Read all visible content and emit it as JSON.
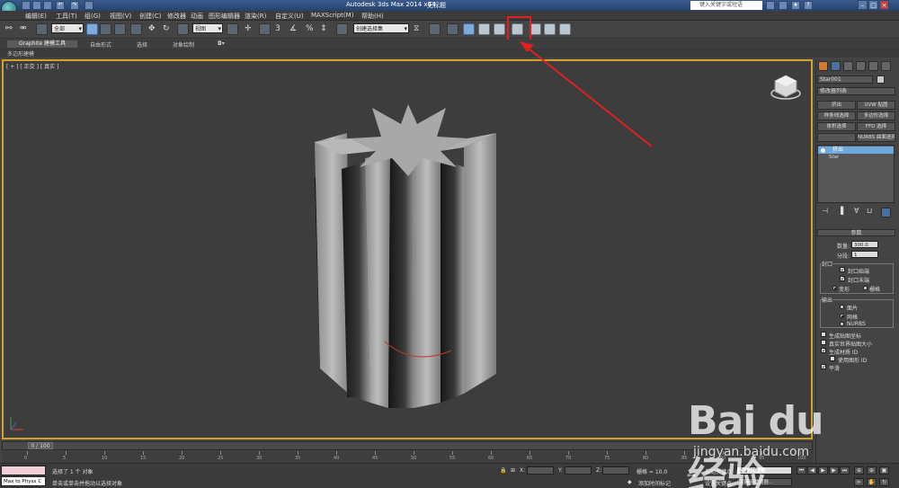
{
  "window": {
    "title": "Autodesk 3ds Max  2014 x64",
    "document": "无标题",
    "help_search_placeholder": "键入关键字或短语"
  },
  "menu": [
    "编辑(E)",
    "工具(T)",
    "组(G)",
    "视图(V)",
    "创建(C)",
    "修改器",
    "动画",
    "图形编辑器",
    "渲染(R)",
    "自定义(U)",
    "MAXScript(M)",
    "帮助(H)"
  ],
  "toolbar": {
    "selection_filter": "全部",
    "ref_coord": "视图",
    "named_selection": "创建选择集"
  },
  "ribbon": {
    "tabs": [
      "Graphite 建模工具",
      "自由形式",
      "选择",
      "对象绘制"
    ],
    "sub_label": "多边形建模"
  },
  "viewport": {
    "label": "[ + ] [ 正交 ] [ 真实 ]"
  },
  "command_panel": {
    "object_name": "Star001",
    "modifier_list": "修改器列表",
    "modifier_buttons": [
      "挤出",
      "UVW 贴图",
      "样条线选择",
      "多边形选择",
      "体积选择",
      "FFD 选择",
      "",
      "NURBS 曲面选择"
    ],
    "stack": {
      "selected": "挤出",
      "base": "Star"
    },
    "params_title": "参数",
    "amount_label": "数量:",
    "amount_value": "300.0",
    "segments_label": "分段:",
    "segments_value": "1",
    "capping_label": "封口",
    "cap_start": "封口始端",
    "cap_end": "封口末端",
    "morph": "变形",
    "grid": "栅格",
    "output_label": "输出",
    "patch": "面片",
    "mesh": "网格",
    "nurbs": "NURBS",
    "gen_mapping": "生成贴图坐标",
    "real_world": "真实世界贴图大小",
    "gen_mat_ids": "生成材质 ID",
    "use_shape_ids": "使用图形 ID",
    "smooth": "平滑"
  },
  "timeline": {
    "frame": "0 / 100",
    "ticks": [
      "0",
      "5",
      "10",
      "15",
      "20",
      "25",
      "30",
      "35",
      "40",
      "45",
      "50",
      "55",
      "60",
      "65",
      "70",
      "75",
      "80",
      "85",
      "90",
      "95",
      "100"
    ]
  },
  "status": {
    "maxscript_text": "Max to Physx C",
    "selected": "选择了 1 个 对象",
    "prompt": "单击或单击并拖动以选择对象",
    "x_label": "X:",
    "y_label": "Y:",
    "z_label": "Z:",
    "grid": "栅格 = 10.0",
    "add_time_tag": "添加时间标记",
    "auto_key": "自动关键点",
    "set_key": "设置关键点",
    "selection_set": "选定对象",
    "key_filters": "关键点过滤器..."
  },
  "watermark": {
    "brand": "Bai du 经验",
    "url": "jingyan.baidu.com"
  },
  "colors": {
    "viewport_bg": "#3d3d3d",
    "viewport_border": "#d6a12a",
    "highlight": "#e02020",
    "active_tab": "#d47b2a",
    "selection_blue": "#6fa8dc"
  }
}
